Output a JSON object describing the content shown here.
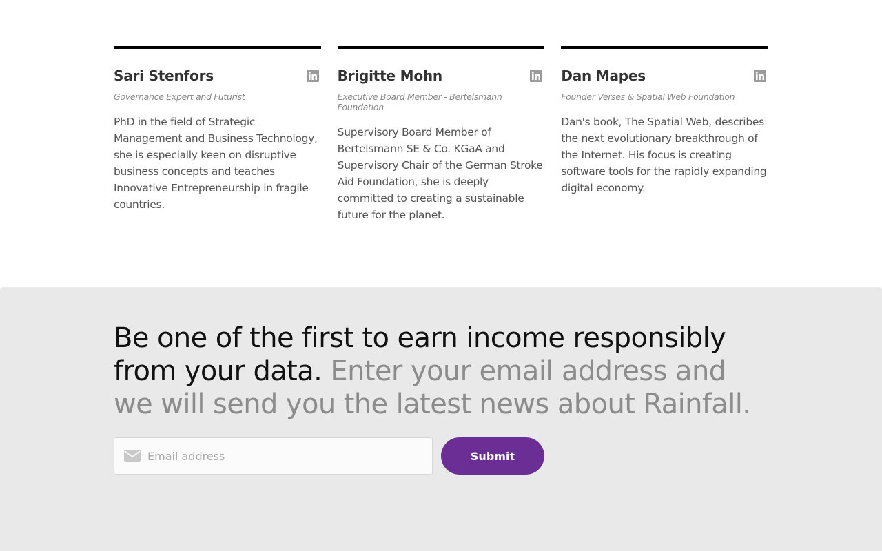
{
  "team": {
    "members": [
      {
        "name": "Sari Stenfors",
        "role": "Governance Expert and Futurist",
        "bio": "PhD in the field of Strategic Management and Business Technology, she is especially keen on disruptive business concepts and teaches Innovative Entrepreneurship in fragile countries.",
        "icon": "linkedin-icon"
      },
      {
        "name": "Brigitte Mohn",
        "role": "Executive Board Member - Bertelsmann Foundation",
        "bio": "Supervisory Board Member of Bertelsmann SE & Co. KGaA and Supervisory Chair of the German Stroke Aid Foundation, she is deeply committed to creating a sustainable future for the planet.",
        "icon": "linkedin-icon"
      },
      {
        "name": "Dan Mapes",
        "role": "Founder Verses & Spatial Web Foundation",
        "bio": "Dan's book, The Spatial Web, describes the next evolutionary breakthrough of the Internet. His focus is creating software tools for the rapidly expanding digital economy.",
        "icon": "linkedin-icon"
      }
    ]
  },
  "signup": {
    "headline": "Be one of the first to earn income responsibly from your data.",
    "subline": "Enter your email address and we will send you the latest news about Rainfall.",
    "email_placeholder": "Email address",
    "email_value": "",
    "email_icon": "envelope-icon",
    "submit_label": "Submit"
  },
  "colors": {
    "accent": "#6b2e94",
    "section_bg": "#e9e9ea",
    "icon_gray": "#9b9b9b"
  }
}
